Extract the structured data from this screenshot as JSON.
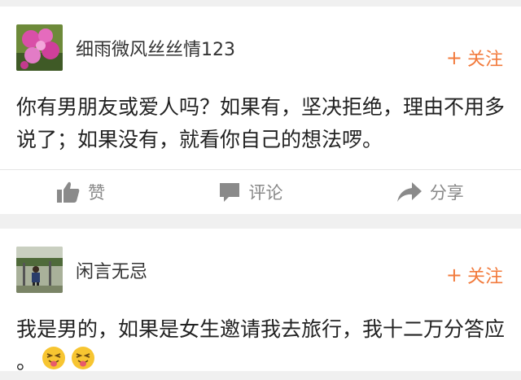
{
  "posts": [
    {
      "username": "细雨微风丝丝情123",
      "follow_label": "关注",
      "content": "你有男朋友或爱人吗？如果有，坚决拒绝，理由不用多说了；如果没有，就看你自己的想法啰。",
      "actions": {
        "like_label": "赞",
        "comment_label": "评论",
        "share_label": "分享"
      }
    },
    {
      "username": "闲言无忌",
      "follow_label": "关注",
      "content": "我是男的，如果是女生邀请我去旅行，我十二万分答应 。",
      "emoji": [
        "tongue-wink-emoji",
        "tongue-wink-emoji"
      ]
    }
  ],
  "colors": {
    "accent": "#f27b3d",
    "icon_gray": "#8a8a8a",
    "background": "#f0f0f0"
  },
  "icons": [
    "thumbs-up-icon",
    "comment-icon",
    "share-arrow-icon",
    "plus-icon"
  ]
}
